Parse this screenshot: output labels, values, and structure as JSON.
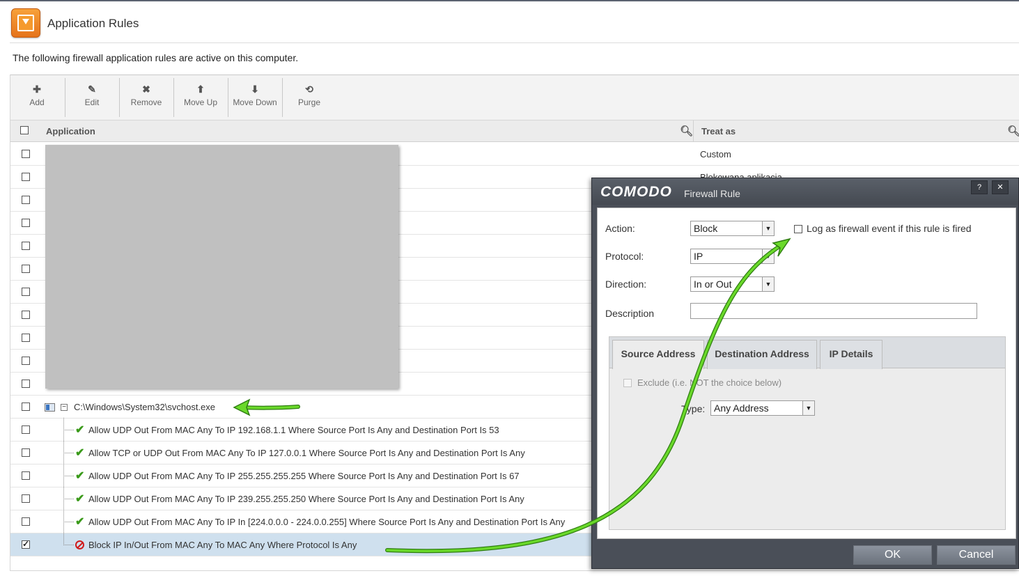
{
  "header": {
    "title": "Application Rules",
    "subtitle": "The following firewall application rules are active on this computer."
  },
  "toolbar": {
    "add": "Add",
    "edit": "Edit",
    "remove": "Remove",
    "move_up": "Move Up",
    "move_down": "Move Down",
    "purge": "Purge"
  },
  "grid": {
    "col_application": "Application",
    "col_treat_as": "Treat as",
    "rows_top": [
      {
        "treat_as": "Custom"
      },
      {
        "treat_as": "Blokowana aplikacja"
      },
      {
        "treat_as": ""
      },
      {
        "treat_as": ""
      },
      {
        "treat_as": ""
      },
      {
        "treat_as": ""
      },
      {
        "treat_as": ""
      },
      {
        "treat_as": ""
      },
      {
        "treat_as": ""
      },
      {
        "treat_as": ""
      },
      {
        "treat_as": ""
      }
    ],
    "svchost": {
      "path": "C:\\Windows\\System32\\svchost.exe"
    },
    "rules": [
      {
        "text": "Allow UDP Out From MAC Any To IP 192.168.1.1 Where Source Port Is Any and Destination Port Is 53",
        "kind": "allow"
      },
      {
        "text": "Allow TCP or UDP Out From MAC Any To IP 127.0.0.1 Where Source Port Is Any and Destination Port Is Any",
        "kind": "allow"
      },
      {
        "text": "Allow UDP Out From MAC Any To IP 255.255.255.255 Where Source Port Is Any and Destination Port Is 67",
        "kind": "allow"
      },
      {
        "text": "Allow UDP Out From MAC Any To IP 239.255.255.250 Where Source Port Is Any and Destination Port Is Any",
        "kind": "allow"
      },
      {
        "text": "Allow UDP Out From MAC Any To IP In [224.0.0.0 - 224.0.0.255] Where Source Port Is Any and Destination Port Is Any",
        "kind": "allow"
      },
      {
        "text": "Block IP In/Out From MAC Any To MAC Any Where Protocol Is Any",
        "kind": "block"
      }
    ]
  },
  "dialog": {
    "brand": "COMODO",
    "title": "Firewall Rule",
    "help": "?",
    "close": "✕",
    "action_label": "Action:",
    "action_value": "Block",
    "log_label": "Log as firewall event if this rule is fired",
    "protocol_label": "Protocol:",
    "protocol_value": "IP",
    "direction_label": "Direction:",
    "direction_value": "In or Out",
    "description_label": "Description",
    "tabs": [
      "Source Address",
      "Destination Address",
      "IP Details"
    ],
    "exclude_label": "Exclude (i.e. NOT the choice below)",
    "type_label": "Type:",
    "type_value": "Any Address",
    "ok": "OK",
    "cancel": "Cancel"
  },
  "colors": {
    "accent_orange": "#f0891f",
    "allow_green": "#3a9a1a",
    "block_red": "#d01b1b",
    "annotation_arrow": "#5fd11e",
    "dialog_frame": "#4a4f58",
    "selected_row": "#cfe0ee"
  }
}
